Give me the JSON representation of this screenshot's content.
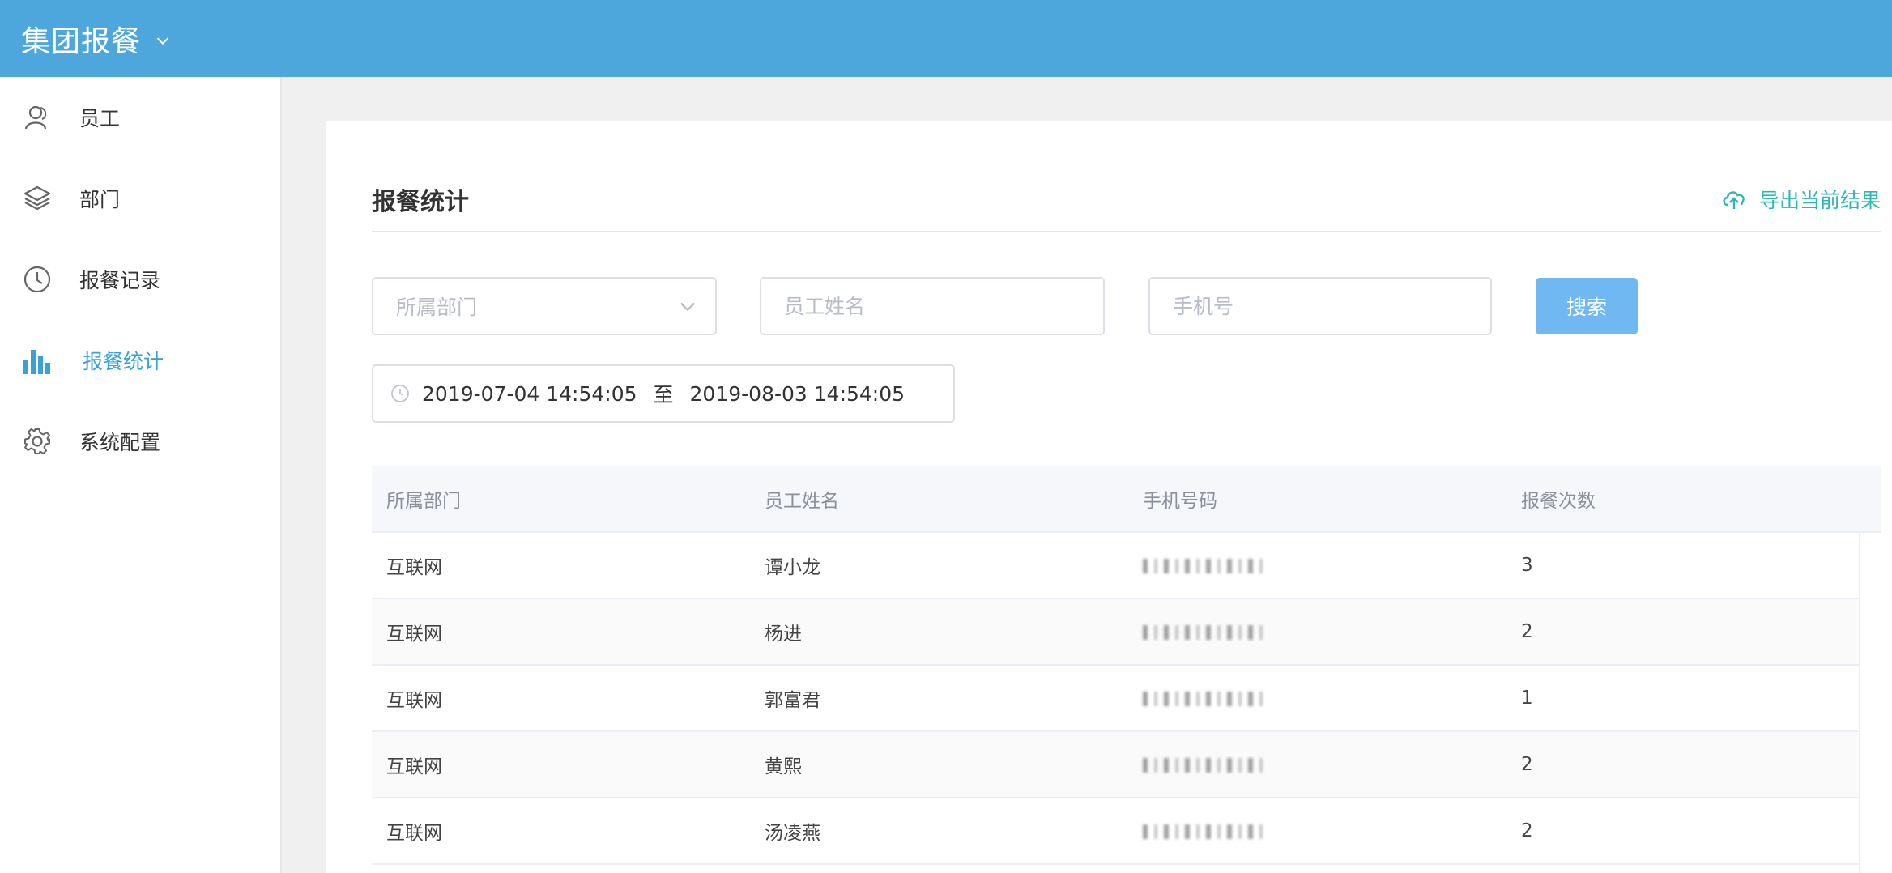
{
  "app": {
    "title": "集团报餐"
  },
  "sidebar": {
    "items": [
      {
        "label": "员工",
        "icon": "user-icon",
        "active": false
      },
      {
        "label": "部门",
        "icon": "layers-icon",
        "active": false
      },
      {
        "label": "报餐记录",
        "icon": "clock-icon",
        "active": false
      },
      {
        "label": "报餐统计",
        "icon": "bar-chart-icon",
        "active": true
      },
      {
        "label": "系统配置",
        "icon": "gear-icon",
        "active": false
      }
    ]
  },
  "main": {
    "title": "报餐统计",
    "export_label": "导出当前结果",
    "filters": {
      "department_placeholder": "所属部门",
      "name_placeholder": "员工姓名",
      "phone_placeholder": "手机号",
      "search_label": "搜索",
      "date_start": "2019-07-04 14:54:05",
      "date_separator": "至",
      "date_end": "2019-08-03 14:54:05"
    },
    "table": {
      "headers": [
        "所属部门",
        "员工姓名",
        "手机号码",
        "报餐次数"
      ],
      "rows": [
        {
          "department": "互联网",
          "name": "谭小龙",
          "count": "3"
        },
        {
          "department": "互联网",
          "name": "杨进",
          "count": "2"
        },
        {
          "department": "互联网",
          "name": "郭富君",
          "count": "1"
        },
        {
          "department": "互联网",
          "name": "黄熙",
          "count": "2"
        },
        {
          "department": "互联网",
          "name": "汤凌燕",
          "count": "2"
        }
      ]
    }
  },
  "colors": {
    "topbar": "#4ea7dc",
    "accent": "#3aa0d8",
    "export": "#2bb7b3",
    "search_button": "#6fb8f2"
  }
}
